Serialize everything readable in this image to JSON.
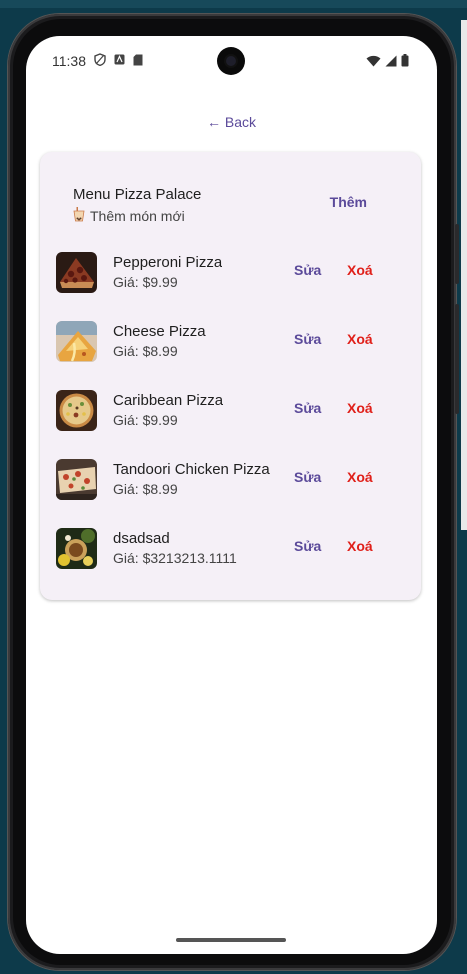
{
  "status": {
    "time": "11:38"
  },
  "nav": {
    "back_label": "← Back"
  },
  "menu": {
    "title": "Menu Pizza Palace",
    "subtitle": "Thêm món mới",
    "add_label": "Thêm",
    "edit_label": "Sửa",
    "delete_label": "Xoá",
    "items": [
      {
        "name": "Pepperoni Pizza",
        "price": "Giá: $9.99",
        "image": "pepperoni-pizza-photo"
      },
      {
        "name": "Cheese Pizza",
        "price": "Giá: $8.99",
        "image": "cheese-pizza-photo"
      },
      {
        "name": "Caribbean Pizza",
        "price": "Giá: $9.99",
        "image": "caribbean-pizza-photo"
      },
      {
        "name": "Tandoori Chicken Pizza",
        "price": "Giá: $8.99",
        "image": "tandoori-pizza-photo"
      },
      {
        "name": "dsadsad",
        "price": "Giá: $3213213.1111",
        "image": "dsadsad-photo"
      }
    ]
  },
  "colors": {
    "accent": "#5b4a9a",
    "danger": "#e0201a",
    "card_bg": "#f5f0f7"
  }
}
